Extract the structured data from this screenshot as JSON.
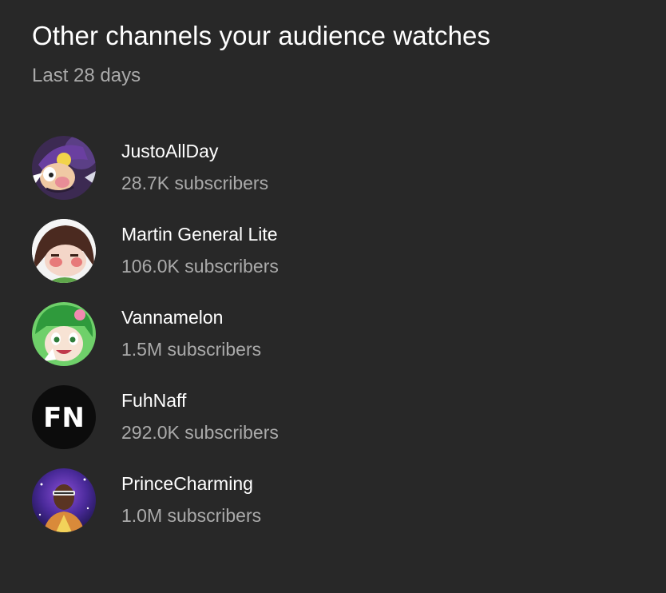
{
  "header": {
    "title": "Other channels your audience watches",
    "subtitle": "Last 28 days"
  },
  "channels": [
    {
      "name": "JustoAllDay",
      "subscribers": "28.7K subscribers",
      "avatar_icon": "purple-cap-cartoon-avatar"
    },
    {
      "name": "Martin General Lite",
      "subscribers": "106.0K subscribers",
      "avatar_icon": "brown-hair-cartoon-avatar"
    },
    {
      "name": "Vannamelon",
      "subscribers": "1.5M subscribers",
      "avatar_icon": "green-hair-cartoon-avatar"
    },
    {
      "name": "FuhNaff",
      "subscribers": "292.0K subscribers",
      "avatar_icon": "fn-logo-avatar",
      "avatar_text": "FN"
    },
    {
      "name": "PrinceCharming",
      "subscribers": "1.0M subscribers",
      "avatar_icon": "galaxy-portrait-avatar"
    }
  ]
}
